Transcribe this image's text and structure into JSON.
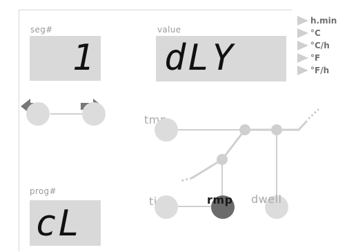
{
  "segment": {
    "label": "seg#",
    "display": "1"
  },
  "value": {
    "label": "value",
    "display": "dLY"
  },
  "program": {
    "label": "prog#",
    "display": "cL"
  },
  "units": [
    "h.min",
    "°C",
    "°C/h",
    "°F",
    "°F/h"
  ],
  "buttons": {
    "tmp": "tmp",
    "time": "time",
    "rmp": "rmp",
    "dwell": "dwell"
  },
  "colors": {
    "lcd_bg": "#d9d9d9",
    "button": "#dcdcdc",
    "button_active": "#6b6b6b",
    "line": "#cfcfcf"
  }
}
